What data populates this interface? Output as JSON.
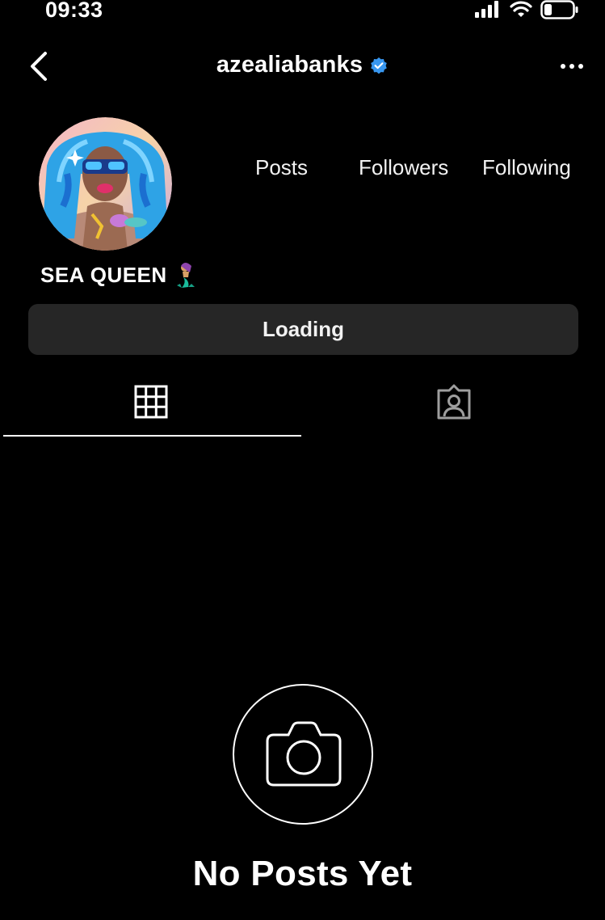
{
  "status_bar": {
    "time": "09:33",
    "icons": [
      "signal-icon",
      "wifi-icon",
      "battery-icon"
    ]
  },
  "header": {
    "username": "azealiabanks",
    "verified": true,
    "back_icon": "chevron-left-icon",
    "more_icon": "more-horizontal-icon"
  },
  "profile": {
    "stats": {
      "posts_label": "Posts",
      "followers_label": "Followers",
      "following_label": "Following"
    },
    "display_name": "SEA QUEEN",
    "display_name_emoji": "mermaid-icon",
    "loading_label": "Loading"
  },
  "tabs": [
    {
      "name": "posts-grid",
      "icon": "grid-icon",
      "active": true
    },
    {
      "name": "tagged",
      "icon": "tagged-person-icon",
      "active": false
    }
  ],
  "empty_state": {
    "icon": "camera-icon",
    "title": "No Posts Yet"
  },
  "colors": {
    "background": "#000000",
    "text": "#ffffff",
    "button_bg": "#262626",
    "verified_blue": "#3897f0"
  }
}
